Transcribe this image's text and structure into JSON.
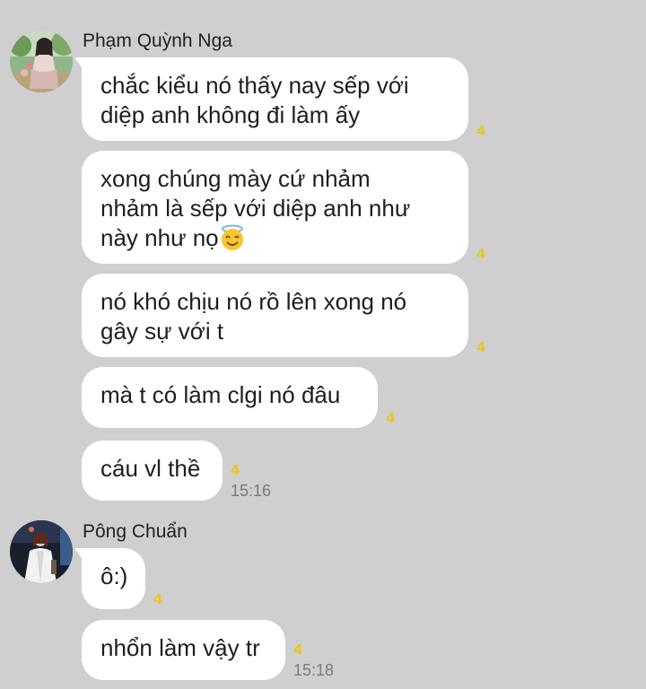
{
  "conversation": [
    {
      "sender": "Phạm Quỳnh Nga",
      "avatar_icon": "user-photo-avatar",
      "messages": [
        {
          "lines": [
            "chắc kiểu nó thấy nay sếp với",
            "diệp anh không đi làm ấy"
          ],
          "seen_count": "4"
        },
        {
          "lines": [
            "xong chúng mày cứ nhảm",
            "nhảm là sếp với diệp anh như",
            "này như nọ"
          ],
          "emoji": "smiling-face-with-halo-emoji",
          "seen_count": "4"
        },
        {
          "lines": [
            "nó khó chịu nó rồ lên xong nó",
            "gây sự với t"
          ],
          "seen_count": "4"
        },
        {
          "lines": [
            "mà t có làm clgi nó đâu"
          ],
          "seen_count": "4"
        },
        {
          "lines": [
            "cáu vl thề"
          ],
          "seen_count": "4",
          "time": "15:16"
        }
      ]
    },
    {
      "sender": "Pông Chuẩn",
      "avatar_icon": "user-photo-avatar",
      "messages": [
        {
          "lines": [
            "ô:)"
          ],
          "seen_count": "4"
        },
        {
          "lines": [
            "nhổn làm vậy tr"
          ],
          "seen_count": "4",
          "time": "15:18"
        }
      ]
    }
  ],
  "colors": {
    "background": "#cfcfcf",
    "bubble": "#ffffff",
    "seen_indicator": "#e6c62b",
    "time_text": "#7a7a7a"
  }
}
